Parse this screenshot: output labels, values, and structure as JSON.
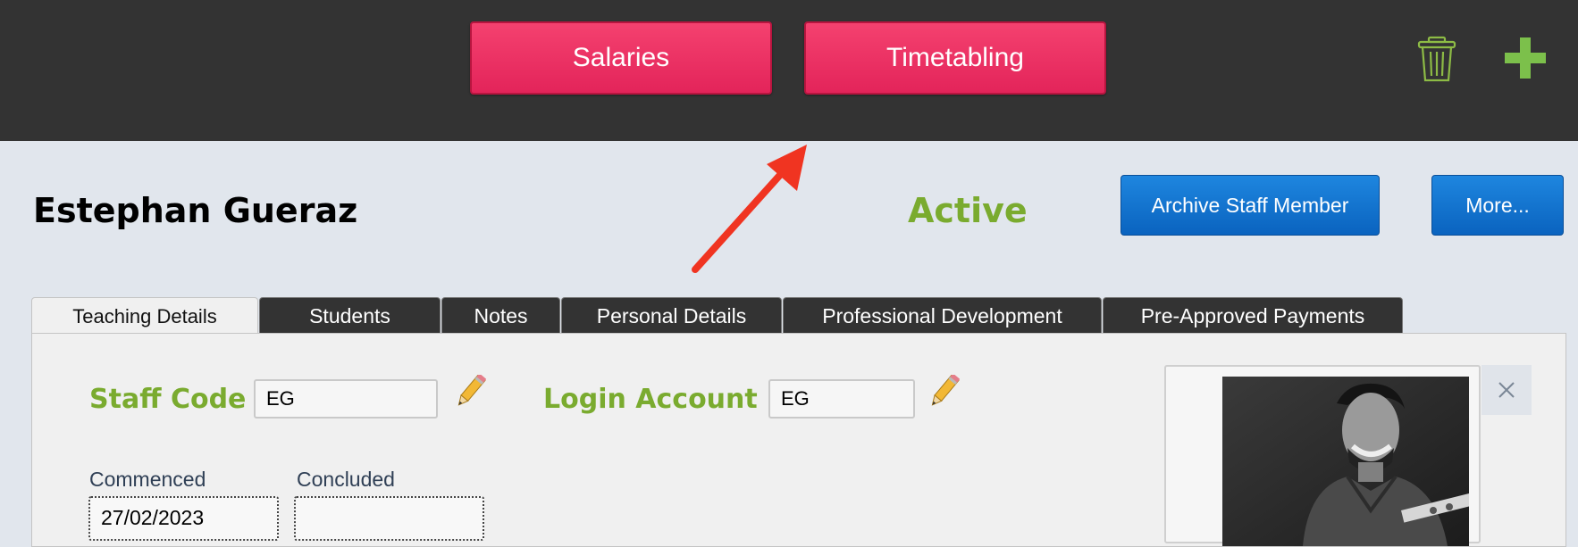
{
  "topbar": {
    "salaries_label": "Salaries",
    "timetabling_label": "Timetabling",
    "trash_icon": "trash-icon",
    "add_icon": "plus-icon",
    "accent_color": "#7aab2f",
    "button_color": "#e82d60"
  },
  "header": {
    "staff_name": "Estephan Gueraz",
    "status": "Active",
    "archive_label": "Archive Staff Member",
    "more_label": "More..."
  },
  "tabs": [
    {
      "label": "Teaching Details",
      "active": true
    },
    {
      "label": "Students"
    },
    {
      "label": "Notes"
    },
    {
      "label": "Personal Details"
    },
    {
      "label": "Professional Development"
    },
    {
      "label": "Pre-Approved Payments"
    }
  ],
  "teaching": {
    "staff_code_label": "Staff Code",
    "staff_code_value": "EG",
    "login_account_label": "Login Account",
    "login_account_value": "EG",
    "commenced_label": "Commenced",
    "commenced_value": "27/02/2023",
    "concluded_label": "Concluded",
    "concluded_value": ""
  },
  "photo": {
    "close_icon": "close-icon"
  }
}
